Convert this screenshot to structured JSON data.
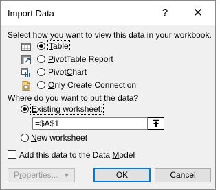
{
  "dialog": {
    "title": "Import Data",
    "help_glyph": "?",
    "close_glyph": "✕"
  },
  "view_section": {
    "prompt": "Select how you want to view this data in your workbook.",
    "options": [
      {
        "icon": "table-icon",
        "label_first": "T",
        "label_rest": "able",
        "checked": true
      },
      {
        "icon": "pivottable-report-icon",
        "label_first": "P",
        "label_rest": "ivotTable Report",
        "checked": false
      },
      {
        "icon": "pivotchart-icon",
        "label_first": "Pivot",
        "label_underline": "C",
        "label_rest": "hart",
        "checked": false
      },
      {
        "icon": "connection-icon",
        "label_first": "O",
        "label_rest": "nly Create Connection",
        "checked": false
      }
    ]
  },
  "location_section": {
    "prompt": "Where do you want to put the data?",
    "existing_first": "E",
    "existing_rest": "xisting worksheet:",
    "existing_checked": true,
    "cell_reference": "=$A$1",
    "new_first": "N",
    "new_rest": "ew worksheet",
    "new_checked": false
  },
  "data_model": {
    "label_pre": "Add this data to the Data ",
    "label_underline": "M",
    "label_post": "odel",
    "checked": false
  },
  "buttons": {
    "properties_pre": "P",
    "properties_underline": "r",
    "properties_post": "operties...",
    "properties_arrow": "▾",
    "ok": "OK",
    "cancel": "Cancel"
  }
}
